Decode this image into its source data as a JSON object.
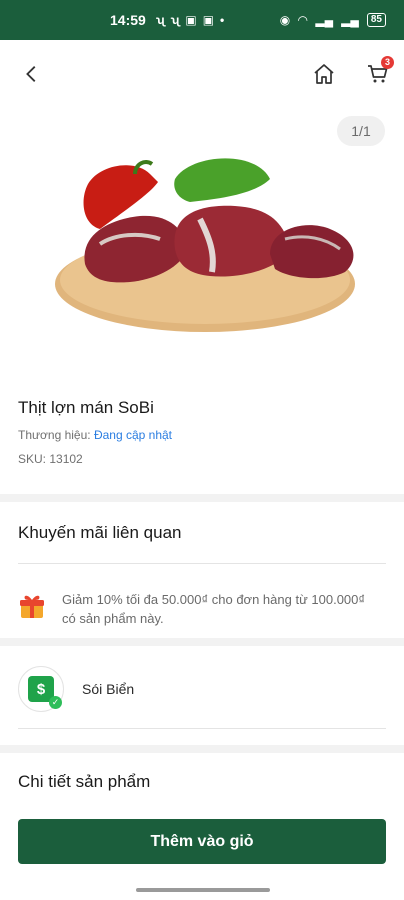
{
  "status_bar": {
    "time": "14:59",
    "battery": "85"
  },
  "nav": {
    "cart_count": "3"
  },
  "gallery": {
    "counter": "1/1"
  },
  "product": {
    "name": "Thịt lợn mán SoBi",
    "brand_label": "Thương hiệu:",
    "brand_value": "Đang cập nhật",
    "sku_label": "SKU:",
    "sku_value": "13102"
  },
  "promotions": {
    "title": "Khuyến mãi liên quan",
    "items": [
      {
        "text": "Giảm 10% tối đa 50.000₫ cho đơn hàng từ 100.000₫ có sản phẩm này."
      }
    ]
  },
  "seller": {
    "name": "Sói Biển"
  },
  "details": {
    "title": "Chi tiết sản phẩm"
  },
  "cta": {
    "add_to_cart": "Thêm vào giỏ"
  },
  "colors": {
    "brand_green": "#1b5e3c",
    "link_blue": "#2a7de1",
    "badge_red": "#e53935"
  }
}
